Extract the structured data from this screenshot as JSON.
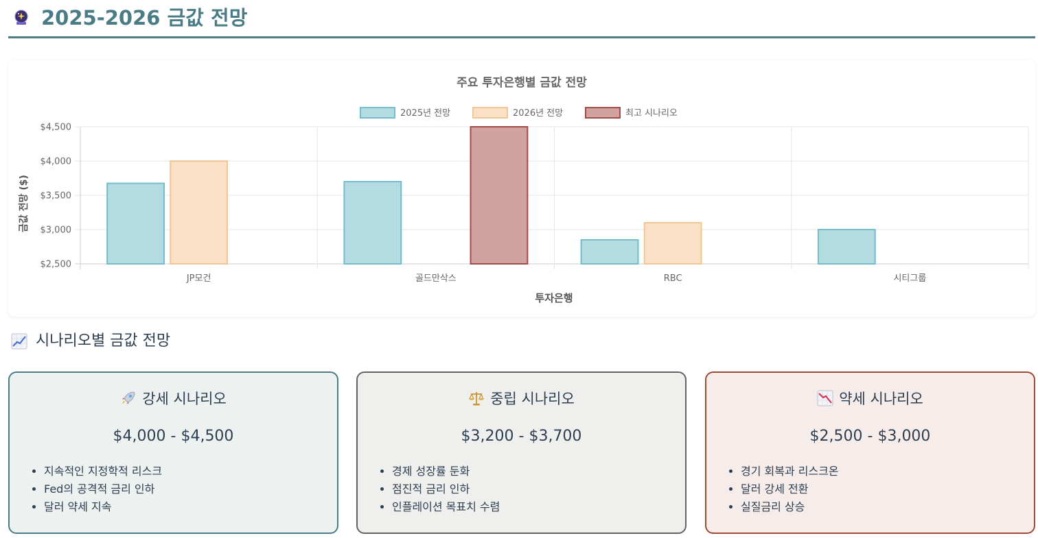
{
  "header": {
    "icon": "crystal-ball-icon",
    "title": "2025-2026 금값 전망"
  },
  "chart_data": {
    "type": "bar",
    "title": "주요 투자은행별 금값 전망",
    "xlabel": "투자은행",
    "ylabel": "금값 전망 ($)",
    "categories": [
      "JP모건",
      "골드만삭스",
      "RBC",
      "시티그룹"
    ],
    "ylim": [
      2500,
      4500
    ],
    "yticks": [
      "$2,500",
      "$3,000",
      "$3,500",
      "$4,000",
      "$4,500"
    ],
    "legend_position": "top-center",
    "grid": true,
    "series": [
      {
        "name": "2025년 전망",
        "values": [
          3675,
          3700,
          2850,
          3000
        ],
        "fill": "#b4dae2",
        "stroke": "#72bccc"
      },
      {
        "name": "2026년 전망",
        "values": [
          4000,
          null,
          3100,
          null
        ],
        "fill": "#f9e0c6",
        "stroke": "#f0c693"
      },
      {
        "name": "최고 시나리오",
        "values": [
          null,
          4500,
          null,
          null
        ],
        "fill": "#d0a2a0",
        "stroke": "#a24a47"
      }
    ]
  },
  "section": {
    "icon": "chart-increasing-icon",
    "title": "시나리오별 금값 전망"
  },
  "scenarios": [
    {
      "icon": "rocket-icon",
      "title": "강세 시나리오",
      "range": "$4,000 - $4,500",
      "points": [
        "지속적인 지정학적 리스크",
        "Fed의 공격적 금리 인하",
        "달러 약세 지속"
      ]
    },
    {
      "icon": "balance-scale-icon",
      "title": "중립 시나리오",
      "range": "$3,200 - $3,700",
      "points": [
        "경제 성장률 둔화",
        "점진적 금리 인하",
        "인플레이션 목표치 수렴"
      ]
    },
    {
      "icon": "chart-decreasing-icon",
      "title": "약세 시나리오",
      "range": "$2,500 - $3,000",
      "points": [
        "경기 회복과 리스크온",
        "달러 강세 전환",
        "실질금리 상승"
      ]
    }
  ]
}
